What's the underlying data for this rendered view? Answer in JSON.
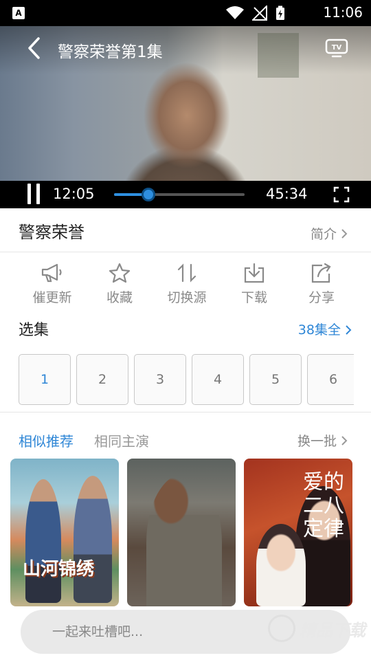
{
  "status": {
    "time": "11:06"
  },
  "player": {
    "title": "警察荣誉第1集",
    "current_time": "12:05",
    "total_time": "45:34",
    "progress_fraction": 0.265
  },
  "info": {
    "show_title": "警察荣誉",
    "intro_label": "简介"
  },
  "actions": [
    {
      "label": "催更新",
      "icon": "megaphone-icon"
    },
    {
      "label": "收藏",
      "icon": "star-icon"
    },
    {
      "label": "切换源",
      "icon": "switch-source-icon"
    },
    {
      "label": "下载",
      "icon": "download-icon"
    },
    {
      "label": "分享",
      "icon": "share-icon"
    }
  ],
  "episodes": {
    "heading": "选集",
    "all_label": "38集全",
    "items": [
      "1",
      "2",
      "3",
      "4",
      "5",
      "6"
    ],
    "active_index": 0
  },
  "recommend": {
    "tabs": [
      "相似推荐",
      "相同主演"
    ],
    "active_tab": 0,
    "refresh_label": "换一批",
    "posters": [
      {
        "caption": "山河锦绣"
      },
      {
        "caption": ""
      },
      {
        "caption": "爱的二八定律"
      }
    ]
  },
  "comment": {
    "placeholder": "一起来吐槽吧..."
  },
  "colors": {
    "accent": "#2e86d6",
    "muted": "#8a8a8a"
  }
}
